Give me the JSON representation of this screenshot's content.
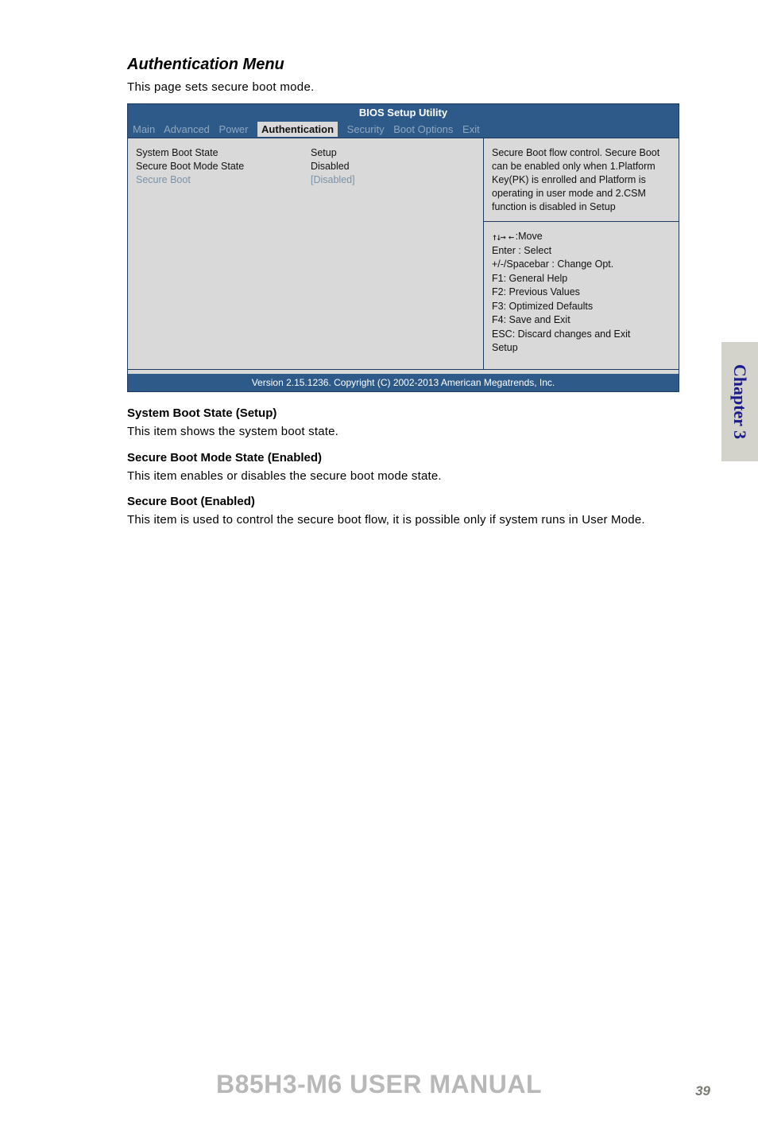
{
  "sideTab": "Chapter 3",
  "sectionTitle": "Authentication Menu",
  "sectionDesc": "This page sets secure boot mode.",
  "bios": {
    "title": "BIOS Setup Utility",
    "menu": {
      "items": [
        "Main",
        "Advanced",
        "Power",
        "Authentication",
        "Security",
        "Boot Options",
        "Exit"
      ],
      "activeIndex": 3
    },
    "rows": [
      {
        "label": "System Boot State",
        "value": "Setup",
        "selected": false
      },
      {
        "label": "Secure Boot Mode State",
        "value": "Disabled",
        "selected": false
      },
      {
        "label": "Secure Boot",
        "value": "[Disabled]",
        "selected": true
      }
    ],
    "help": "Secure Boot  flow control. Secure Boot can be enabled only when 1.Platform Key(PK) is enrolled and Platform is operating in user mode and 2.CSM function is disabled in Setup",
    "keys": {
      "moveGlyph": "↑↓→ ←",
      "move": ":Move",
      "enter": "Enter : Select",
      "spacebar": "+/-/Spacebar  : Change Opt.",
      "f1": "F1: General Help",
      "f2": "F2: Previous Values",
      "f3": "F3: Optimized Defaults",
      "f4": "F4: Save and Exit",
      "esc": "ESC: Discard changes and Exit",
      "setup": "Setup"
    },
    "footer": "Version 2.15.1236. Copyright (C) 2002-2013 American Megatrends,  Inc."
  },
  "sections": [
    {
      "head": "System Boot State (Setup)",
      "body": "This item shows the system boot state."
    },
    {
      "head": "Secure Boot Mode State (Enabled)",
      "body": "This item enables or disables the secure boot mode state."
    },
    {
      "head": "Secure Boot (Enabled)",
      "body": "This item is used to control the secure boot flow, it is possible only if system runs in User Mode."
    }
  ],
  "footerTitle": "B85H3-M6 USER MANUAL",
  "pageNum": "39"
}
